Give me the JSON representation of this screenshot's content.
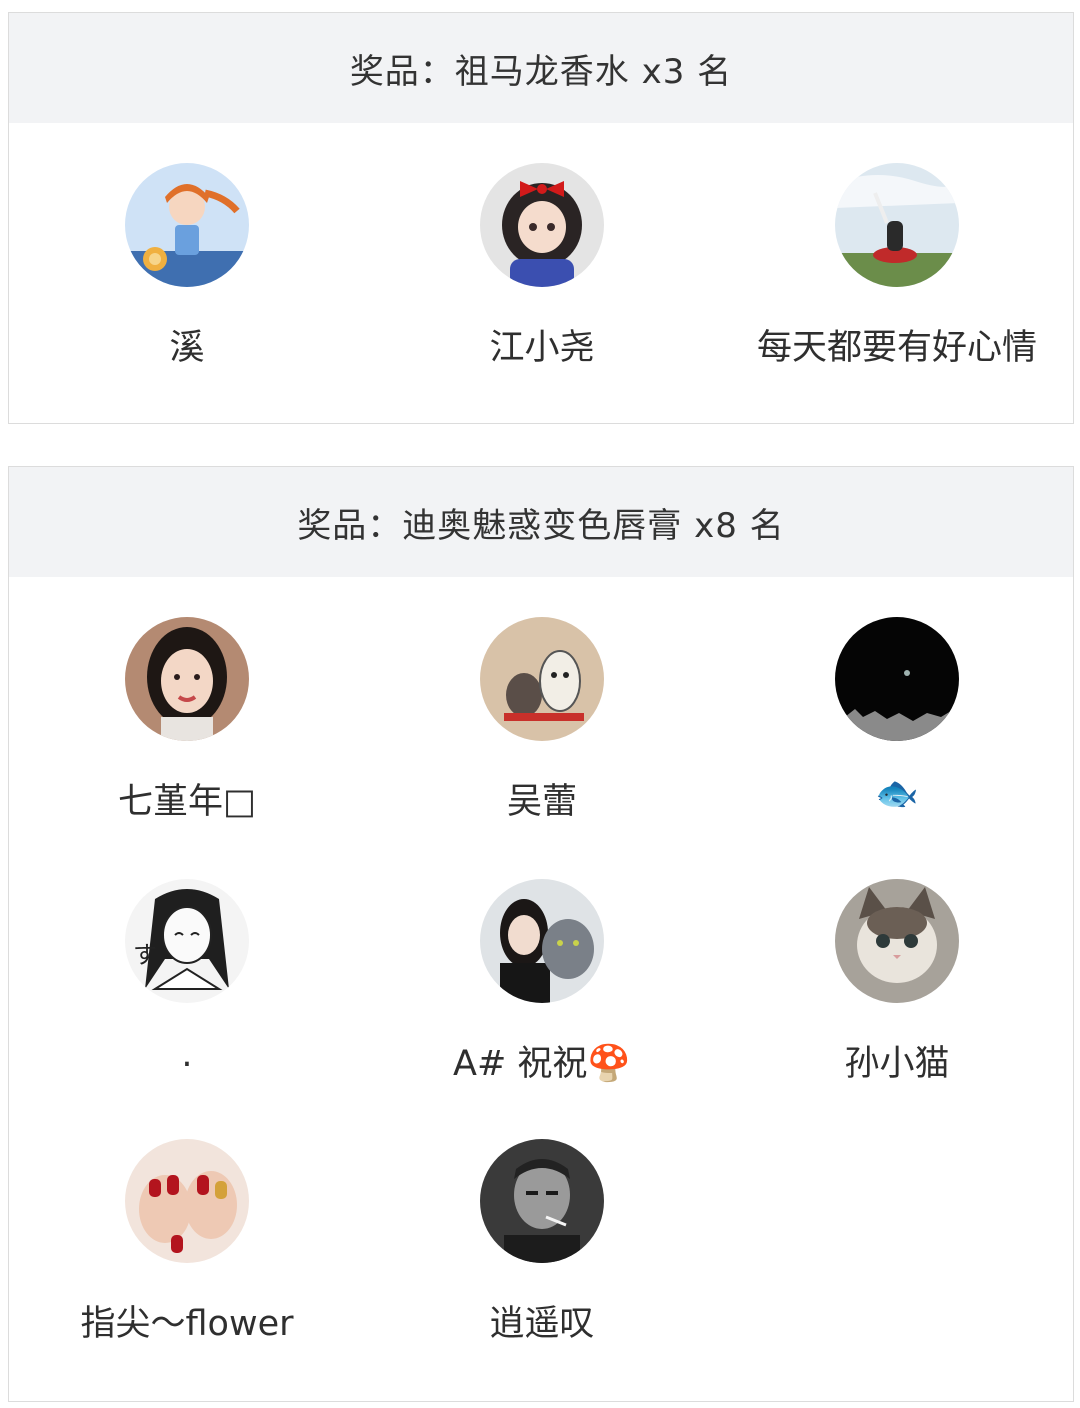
{
  "sections": [
    {
      "title": "奖品：祖马龙香水 x3 名",
      "winners": [
        {
          "name": "溪",
          "avatar": "cartoon-girl-lion-avatar"
        },
        {
          "name": "江小尧",
          "avatar": "snow-white-cartoon-avatar"
        },
        {
          "name": "每天都要有好心情",
          "avatar": "girl-on-hill-photo-avatar"
        }
      ]
    },
    {
      "title": "奖品：迪奥魅惑变色唇膏 x8 名",
      "winners": [
        {
          "name": "七堇年□",
          "avatar": "woman-portrait-avatar"
        },
        {
          "name": "吴蕾",
          "avatar": "lucky-cats-avatar"
        },
        {
          "name": "🐟",
          "avatar": "night-sky-moon-avatar"
        },
        {
          "name": ".",
          "avatar": "manga-girl-sketch-avatar"
        },
        {
          "name": "A# 祝祝🍄",
          "avatar": "woman-with-cat-avatar"
        },
        {
          "name": "孙小猫",
          "avatar": "kitten-photo-avatar"
        },
        {
          "name": "指尖～flower",
          "avatar": "red-nails-avatar"
        },
        {
          "name": "逍遥叹",
          "avatar": "bw-man-smoking-avatar"
        }
      ]
    }
  ]
}
